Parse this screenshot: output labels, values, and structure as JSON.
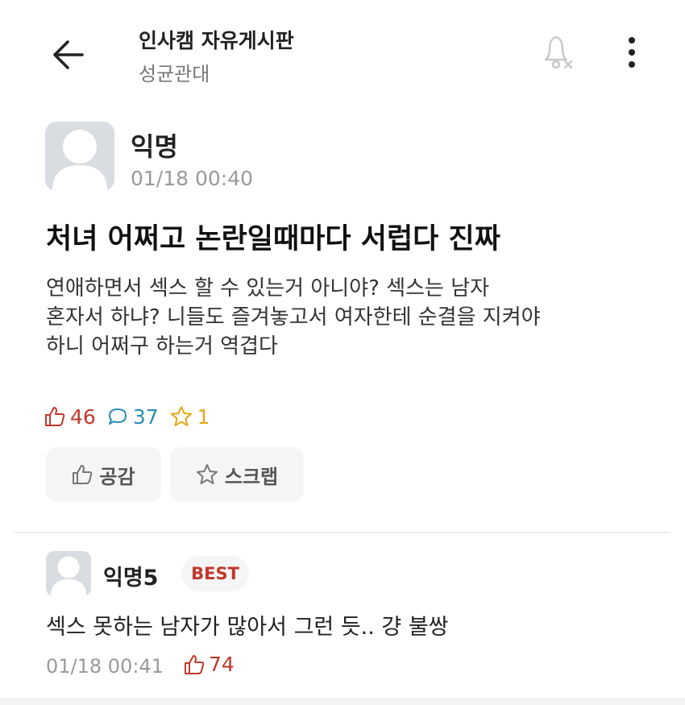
{
  "header": {
    "title": "인사캠 자유게시판",
    "subtitle": "성균관대",
    "icons": {
      "back": "arrow-left-icon",
      "notification": "bell-off-icon",
      "more": "more-vertical-icon"
    }
  },
  "post": {
    "author": "익명",
    "time": "01/18 00:40",
    "title": "처녀 어쩌고 논란일때마다 서럽다 진짜",
    "body_lines": [
      "연애하면서 섹스 할 수 있는거 아니야? 섹스는 남자",
      "혼자서 하냐? 니들도 즐겨놓고서 여자한테 순결을 지켜야",
      "하니 어쩌구 하는거 역겹다"
    ],
    "likes": "46",
    "comments": "37",
    "scraps": "1"
  },
  "actions": {
    "like_label": "공감",
    "scrap_label": "스크랩"
  },
  "comment": {
    "author": "익명5",
    "badge": "BEST",
    "text": "섹스 못하는 남자가 많아서 그런 듯.. 걍 불쌍",
    "time": "01/18 00:41",
    "likes": "74"
  },
  "colors": {
    "like": "#c0392b",
    "comment": "#2a8db3",
    "scrap": "#e3a817",
    "muted": "#9a9a9a",
    "button_bg": "#f5f5f5"
  }
}
